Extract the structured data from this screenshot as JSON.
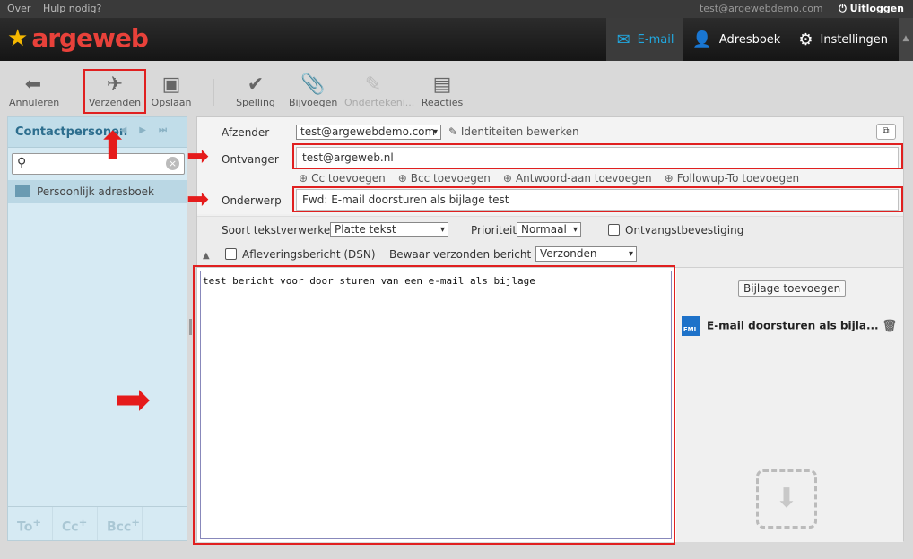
{
  "topbar": {
    "links": [
      "Over",
      "Hulp nodig?"
    ],
    "user_email": "test@argewebdemo.com",
    "logout": "Uitloggen"
  },
  "brand": {
    "name": "argeweb",
    "color": "#e8413a",
    "star_color": "#f5b800"
  },
  "nav": {
    "email": "E-mail",
    "addressbook": "Adresboek",
    "settings": "Instellingen"
  },
  "toolbar": {
    "cancel": "Annuleren",
    "send": "Verzenden",
    "save": "Opslaan",
    "spelling": "Spelling",
    "attach": "Bijvoegen",
    "sign": "Ondertekeni...",
    "responses": "Reacties"
  },
  "contacts": {
    "title": "Contactpersonen",
    "search_placeholder": "",
    "addressbook_label": "Persoonlijk adresboek",
    "to": "To",
    "cc": "Cc",
    "bcc": "Bcc"
  },
  "compose": {
    "from_label": "Afzender",
    "from_value": "test@argewebdemo.com",
    "edit_identities": "Identiteiten bewerken",
    "to_label": "Ontvanger",
    "to_value": "test@argeweb.nl",
    "add_links": [
      "Cc toevoegen",
      "Bcc toevoegen",
      "Antwoord-aan toevoegen",
      "Followup-To toevoegen"
    ],
    "subject_label": "Onderwerp",
    "subject_value": "Fwd: E-mail doorsturen als bijlage test",
    "editor_type_label": "Soort tekstverwerker",
    "editor_type_value": "Platte tekst",
    "priority_label": "Prioriteit",
    "priority_value": "Normaal",
    "receipt_label": "Ontvangstbevestiging",
    "dsn_label": "Afleveringsbericht (DSN)",
    "save_sent_label": "Bewaar verzonden bericht in",
    "save_sent_value": "Verzonden",
    "body": "test bericht voor door sturen van een e-mail als bijlage"
  },
  "attachments": {
    "add_button": "Bijlage toevoegen",
    "items": [
      {
        "name": "E-mail doorsturen als bijla...",
        "type": "EML"
      }
    ]
  },
  "colors": {
    "accent": "#21a8e0",
    "highlight": "#e02020"
  }
}
